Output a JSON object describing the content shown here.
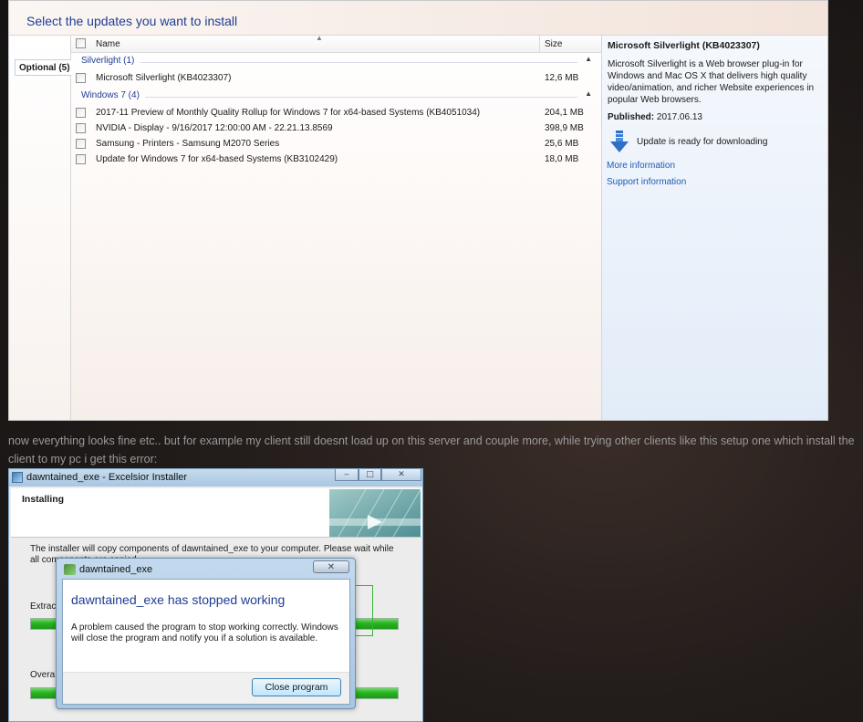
{
  "update_window": {
    "title": "Select the updates you want to install",
    "left_tab": "Optional (5)",
    "columns": {
      "name": "Name",
      "size": "Size"
    },
    "groups": [
      {
        "label": "Silverlight (1)",
        "items": [
          {
            "name": "Microsoft Silverlight (KB4023307)",
            "size": "12,6 MB"
          }
        ]
      },
      {
        "label": "Windows 7 (4)",
        "items": [
          {
            "name": "2017-11 Preview of Monthly Quality Rollup for Windows 7 for x64-based Systems (KB4051034)",
            "size": "204,1 MB"
          },
          {
            "name": "NVIDIA - Display - 9/16/2017 12:00:00 AM - 22.21.13.8569",
            "size": "398,9 MB"
          },
          {
            "name": "Samsung - Printers - Samsung M2070 Series",
            "size": "25,6 MB"
          },
          {
            "name": "Update for Windows 7 for x64-based Systems (KB3102429)",
            "size": "18,0 MB"
          }
        ]
      }
    ],
    "detail": {
      "title": "Microsoft Silverlight (KB4023307)",
      "description": "Microsoft Silverlight is a Web browser plug-in for Windows and Mac OS X that delivers high quality video/animation, and richer Website experiences in popular Web browsers.",
      "published_label": "Published:",
      "published_value": "2017.06.13",
      "status": "Update is ready for downloading",
      "more_info": "More information",
      "support_info": "Support information"
    }
  },
  "post_text": "now everything looks fine etc.. but for example my client still doesnt load up on this server and couple more, while trying other clients like this setup one which install the client to my pc i get this error:",
  "installer": {
    "title": "dawntained_exe - Excelsior Installer",
    "heading": "Installing",
    "message": "The installer will copy components of dawntained_exe to your computer. Please wait while all components are copied.",
    "extract_label": "Extrac",
    "overall_label": "Overa",
    "minimize": "‒",
    "maximize": "□",
    "close": "✕"
  },
  "error_dialog": {
    "title": "dawntained_exe",
    "heading": "dawntained_exe has stopped working",
    "description": "A problem caused the program to stop working correctly. Windows will close the program and notify you if a solution is available.",
    "close_button": "Close program",
    "close_glyph": "✕"
  },
  "colors": {
    "link_blue": "#1e5bb8",
    "heading_blue": "#1e3d92",
    "progress_green": "#27b420"
  }
}
